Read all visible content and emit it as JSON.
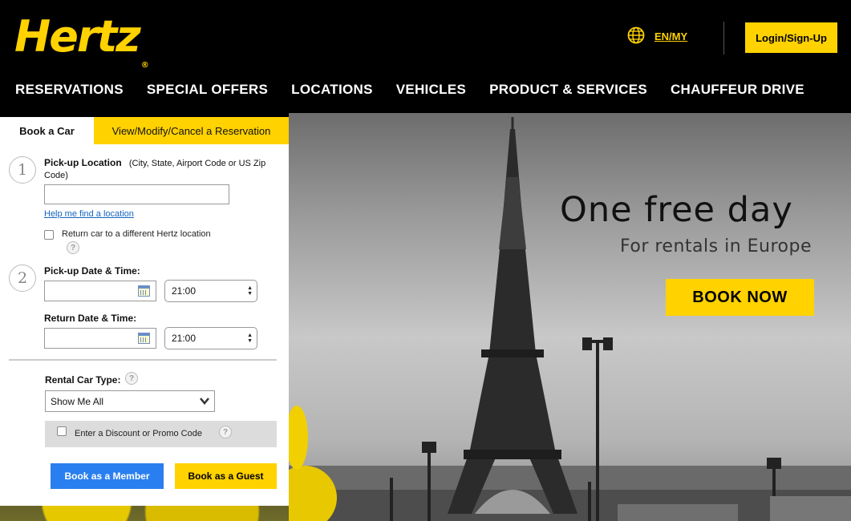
{
  "brand": {
    "logo_text": "Hertz",
    "registered_mark": "®",
    "accent_color": "#ffd200"
  },
  "header": {
    "language_label": "EN/MY",
    "globe_icon": "globe-icon",
    "login_label": "Login/Sign-Up"
  },
  "nav": {
    "items": [
      {
        "label": "RESERVATIONS"
      },
      {
        "label": "SPECIAL OFFERS"
      },
      {
        "label": "LOCATIONS"
      },
      {
        "label": "VEHICLES"
      },
      {
        "label": "PRODUCT & SERVICES"
      },
      {
        "label": "CHAUFFEUR DRIVE"
      }
    ]
  },
  "booking": {
    "tabs": {
      "book": "Book a Car",
      "modify": "View/Modify/Cancel a Reservation"
    },
    "step1_number": "1",
    "step2_number": "2",
    "pickup_location_label": "Pick-up Location",
    "pickup_location_hint": "(City, State, Airport Code or US Zip Code)",
    "pickup_location_value": "",
    "help_find_location": "Help me find a location",
    "return_different_label": "Return car to a different Hertz location",
    "pickup_datetime_label": "Pick-up Date & Time:",
    "pickup_date_value": "",
    "pickup_time_value": "21:00",
    "return_datetime_label": "Return Date & Time:",
    "return_date_value": "",
    "return_time_value": "21:00",
    "car_type_label": "Rental Car Type:",
    "car_type_value": "Show Me All",
    "promo_label": "Enter a Discount or Promo Code",
    "help_glyph": "?",
    "book_member_label": "Book as a Member",
    "book_guest_label": "Book as a Guest"
  },
  "hero": {
    "headline": "One free day",
    "subhead": "For rentals in Europe",
    "cta_label": "BOOK NOW"
  }
}
